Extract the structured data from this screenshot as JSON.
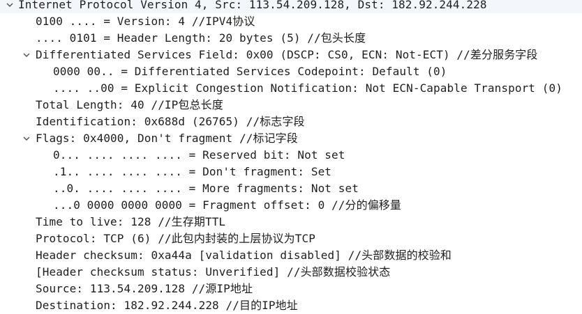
{
  "root": {
    "expanded": true,
    "label": "Internet Protocol Version 4, Src: 113.54.209.128, Dst: 182.92.244.228"
  },
  "fields": [
    {
      "id": "version",
      "level": 1,
      "expandable": false,
      "label": "0100 .... = Version: 4 //IPV4协议"
    },
    {
      "id": "header-length",
      "level": 1,
      "expandable": false,
      "label": ".... 0101 = Header Length: 20 bytes (5) //包头长度"
    },
    {
      "id": "dsfield",
      "level": 1,
      "expandable": true,
      "expanded": true,
      "label": "Differentiated Services Field: 0x00 (DSCP: CS0, ECN: Not-ECT) //差分服务字段"
    },
    {
      "id": "dscp",
      "level": 2,
      "expandable": false,
      "label": "0000 00.. = Differentiated Services Codepoint: Default (0)"
    },
    {
      "id": "ecn",
      "level": 2,
      "expandable": false,
      "label": ".... ..00 = Explicit Congestion Notification: Not ECN-Capable Transport (0)"
    },
    {
      "id": "total-length",
      "level": 1,
      "expandable": false,
      "label": "Total Length: 40 //IP包总长度"
    },
    {
      "id": "identification",
      "level": 1,
      "expandable": false,
      "label": "Identification: 0x688d (26765) //标志字段"
    },
    {
      "id": "flags",
      "level": 1,
      "expandable": true,
      "expanded": true,
      "label": "Flags: 0x4000, Don't fragment //标记字段"
    },
    {
      "id": "reserved-bit",
      "level": 2,
      "expandable": false,
      "label": "0... .... .... .... = Reserved bit: Not set"
    },
    {
      "id": "dont-fragment",
      "level": 2,
      "expandable": false,
      "label": ".1.. .... .... .... = Don't fragment: Set"
    },
    {
      "id": "more-fragments",
      "level": 2,
      "expandable": false,
      "label": "..0. .... .... .... = More fragments: Not set"
    },
    {
      "id": "fragment-offset",
      "level": 2,
      "expandable": false,
      "label": "...0 0000 0000 0000 = Fragment offset: 0 //分的偏移量"
    },
    {
      "id": "ttl",
      "level": 1,
      "expandable": false,
      "label": "Time to live: 128 //生存期TTL"
    },
    {
      "id": "protocol",
      "level": 1,
      "expandable": false,
      "label": "Protocol: TCP (6) //此包内封装的上层协议为TCP"
    },
    {
      "id": "checksum",
      "level": 1,
      "expandable": false,
      "label": "Header checksum: 0xa44a [validation disabled] //头部数据的校验和"
    },
    {
      "id": "checksum-status",
      "level": 1,
      "expandable": false,
      "label": "[Header checksum status: Unverified] //头部数据校验状态"
    },
    {
      "id": "source",
      "level": 1,
      "expandable": false,
      "label": "Source: 113.54.209.128 //源IP地址"
    },
    {
      "id": "destination",
      "level": 1,
      "expandable": false,
      "label": "Destination: 182.92.244.228 //目的IP地址"
    }
  ],
  "colors": {
    "text": "#1e1e1e",
    "chevron": "#555555",
    "background": "#ffffff"
  },
  "icons": {
    "expanded": "chevron-down-icon"
  }
}
